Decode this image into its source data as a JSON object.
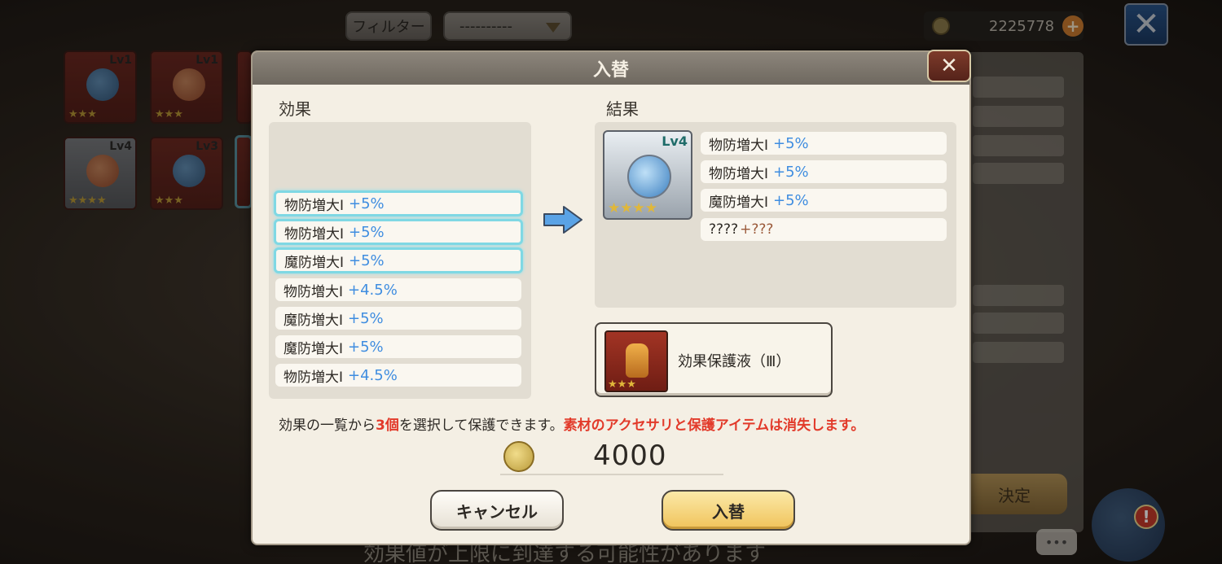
{
  "top_bar": {
    "filter_label": "フィルター",
    "filter_value": "----------",
    "currency_amount": "2225778"
  },
  "inventory": [
    {
      "lv": "Lv1",
      "stars": "★★★"
    },
    {
      "lv": "Lv1",
      "stars": "★★★"
    },
    {
      "lv": "Lv4",
      "stars": "★★★★"
    },
    {
      "lv": "Lv3",
      "stars": "★★★"
    }
  ],
  "background": {
    "decide_label": "決定",
    "bottom_hint": "効果値が上限に到達する可能性があります"
  },
  "modal": {
    "title": "入替",
    "effects_label": "効果",
    "result_label": "結果",
    "effects": [
      {
        "name": "物防増大Ⅰ",
        "value": "+5%"
      },
      {
        "name": "物防増大Ⅰ",
        "value": "+5%"
      },
      {
        "name": "魔防増大Ⅰ",
        "value": "+5%"
      },
      {
        "name": "物防増大Ⅰ",
        "value": "+4.5%"
      },
      {
        "name": "魔防増大Ⅰ",
        "value": "+5%"
      },
      {
        "name": "魔防増大Ⅰ",
        "value": "+5%"
      },
      {
        "name": "物防増大Ⅰ",
        "value": "+4.5%"
      }
    ],
    "result_item": {
      "lv": "Lv4",
      "stars": "★★★★"
    },
    "results": [
      {
        "name": "物防増大Ⅰ",
        "value": "+5%"
      },
      {
        "name": "物防増大Ⅰ",
        "value": "+5%"
      },
      {
        "name": "魔防増大Ⅰ",
        "value": "+5%"
      },
      {
        "name": "????",
        "value": "+???"
      }
    ],
    "protect_item": {
      "name": "効果保護液（Ⅲ）",
      "stars": "★★★"
    },
    "notice_part1": "効果の一覧から",
    "notice_count": "3個",
    "notice_part2": "を選択して保護できます。",
    "notice_warning": "素材のアクセサリと保護アイテムは消失します。",
    "cost": "4000",
    "cancel_label": "キャンセル",
    "swap_label": "入替"
  },
  "colors": {
    "effect_value": "#3f8de0",
    "warning": "#e23a2a",
    "selected_outline": "#7fd8e4"
  }
}
